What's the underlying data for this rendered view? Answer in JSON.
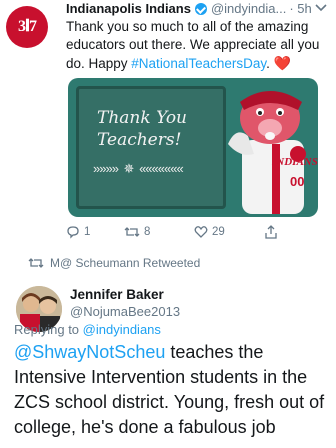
{
  "tweet1": {
    "name": "Indianapolis Indians",
    "handle": "@indyindia...",
    "time": "· 5h",
    "avatar_text": "3𝐈7",
    "text_before": "Thank you so much to all of the amazing educators out there. We appreciate all you do. Happy ",
    "hashtag": "#NationalTeachersDay",
    "text_after": ". ",
    "heart": "❤️",
    "image": {
      "chalk_line1": "Thank You",
      "chalk_line2": "Teachers!",
      "arrows_left": "»»»»",
      "arrows_right": "«««««««",
      "jersey_text": "INDIANS",
      "jersey_number": "00"
    },
    "actions": {
      "reply_count": "1",
      "retweet_count": "8",
      "like_count": "29"
    }
  },
  "retweet_note": "M@ Scheumann Retweeted",
  "tweet2": {
    "name": "Jennifer Baker",
    "handle": "@NojumaBee2013",
    "replying_prefix": "Replying to ",
    "replying_to": "@indyindians",
    "mention": "@ShwayNotScheu",
    "text": " teaches the Intensive Intervention students in the ZCS school district. Young, fresh out of college, he's done a fabulous job"
  },
  "colors": {
    "link": "#1da1f2",
    "secondary": "#657786",
    "brand_red": "#c8102e"
  }
}
